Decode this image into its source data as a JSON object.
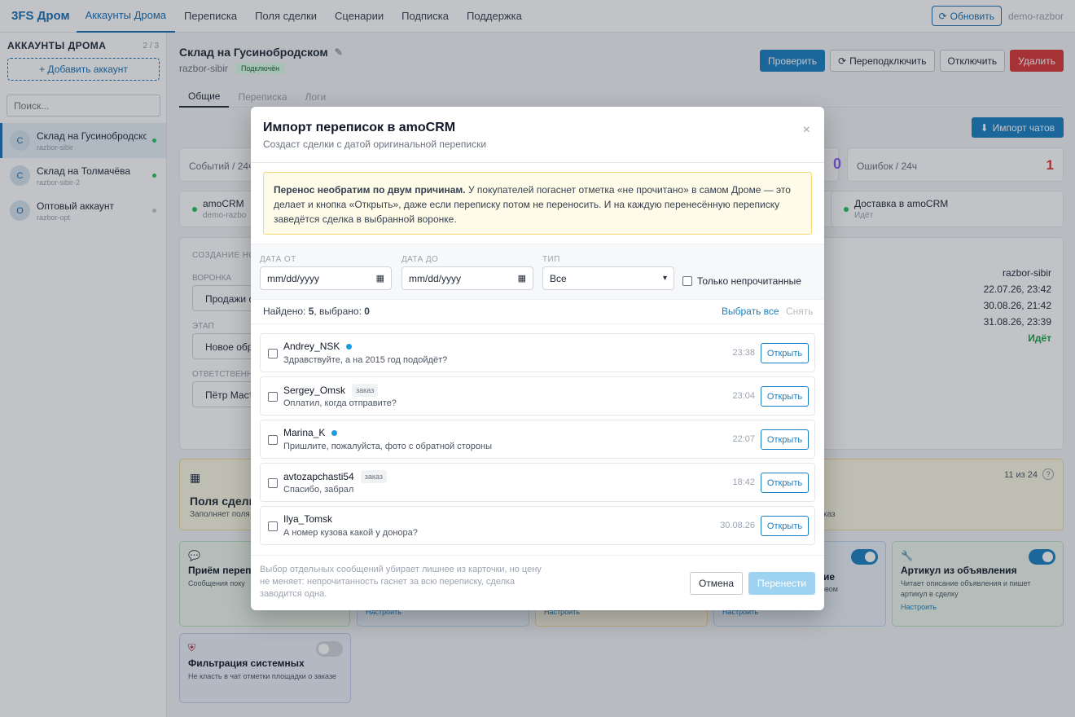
{
  "topbar": {
    "brand": "3FS Дром",
    "nav": [
      "Аккаунты Дрома",
      "Переписка",
      "Поля сделки",
      "Сценарии",
      "Подписка",
      "Поддержка"
    ],
    "refresh_label": "Обновить",
    "user": "demo-razbor"
  },
  "sidebar": {
    "title": "АККАУНТЫ ДРОМА",
    "count": "2 / 3",
    "add_label": "+ Добавить аккаунт",
    "search_placeholder": "Поиск...",
    "accounts": [
      {
        "initial": "С",
        "name": "Склад на Гусинобродском",
        "login": "razbor-sibir"
      },
      {
        "initial": "С",
        "name": "Склад на Толмачёва",
        "login": "razbor-sibir-2"
      },
      {
        "initial": "О",
        "name": "Оптовый аккаунт",
        "login": "razbor-opt"
      }
    ]
  },
  "main": {
    "title": "Склад на Гусинобродском",
    "login": "razbor-sibir",
    "status": "Подключён",
    "actions": {
      "check": "Проверить",
      "reconnect": "Переподключить",
      "disconnect": "Отключить",
      "delete": "Удалить"
    },
    "tabs": [
      "Общие",
      "Переписка",
      "Логи"
    ],
    "import_label": "Импорт чатов",
    "stats": {
      "events_label": "Событий / 24ч",
      "errors_label": "Ошибок / 24ч",
      "errors_value": "1",
      "partial_value": "0"
    },
    "integrations": {
      "amocrm_title": "amoCRM",
      "amocrm_sub": "demo-razbo",
      "delivery_title": "Доставка в amoCRM",
      "delivery_sub": "Идёт"
    },
    "deal": {
      "section": "СОЗДАНИЕ НО",
      "pipeline_label": "ВОРОНКА",
      "pipeline_value": "Продажи с",
      "stage_label": "ЭТАП",
      "stage_value": "Новое обр",
      "resp_label": "ОТВЕТСТВЕНН",
      "resp_value": "Пётр Маст"
    },
    "info": {
      "login": "razbor-sibir",
      "date1": "22.07.26, 23:42",
      "date2": "30.08.26, 21:42",
      "date3": "31.08.26, 23:39",
      "status": "Идёт"
    },
    "fields_card": {
      "title": "Поля сделки",
      "desc": "Заполняет поля",
      "count": "11 из 24",
      "help": "?",
      "tail": "каз"
    },
    "features": {
      "f1_title": "Приём переп",
      "f1_desc": "Сообщения поку",
      "f2_link": "Настроить",
      "f3_link": "Настроить",
      "f4_title": "щение",
      "f4_desc": "ервом",
      "f4_link": "Настроить",
      "f5_title": "Артикул из объявления",
      "f5_desc": "Читает описание объявления и пишет артикул в сделку",
      "f5_link": "Настроить",
      "f6_title": "Фильтрация системных",
      "f6_desc": "Не класть в чат отметки площадки о заказе"
    }
  },
  "modal": {
    "title": "Импорт переписок в amoCRM",
    "subtitle": "Создаст сделки с датой оригинальной переписки",
    "close": "×",
    "warning_bold": "Перенос необратим по двум причинам.",
    "warning_text": " У покупателей погаснет отметка «не прочитано» в самом Дроме — это делает и кнопка «Открыть», даже если переписку потом не переносить. И на каждую перенесённую переписку заведётся сделка в выбранной воронке.",
    "filters": {
      "date_from_label": "ДАТА ОТ",
      "date_from_value": "mm/dd/yyyy",
      "date_to_label": "ДАТА ДО",
      "date_to_value": "mm/dd/yyyy",
      "type_label": "ТИП",
      "type_value": "Все",
      "unread_only": "Только непрочитанные"
    },
    "found_prefix": "Найдено: ",
    "found_count": "5",
    "selected_prefix": ", выбрано: ",
    "selected_count": "0",
    "select_all": "Выбрать все",
    "deselect": "Снять",
    "open_label": "Открыть",
    "chats": [
      {
        "name": "Andrey_NSK",
        "msg": "Здравствуйте, а на 2015 год подойдёт?",
        "time": "23:38",
        "unread": true,
        "tag": ""
      },
      {
        "name": "Sergey_Omsk",
        "msg": "Оплатил, когда отправите?",
        "time": "23:04",
        "unread": false,
        "tag": "заказ"
      },
      {
        "name": "Marina_K",
        "msg": "Пришлите, пожалуйста, фото с обратной стороны",
        "time": "22:07",
        "unread": true,
        "tag": ""
      },
      {
        "name": "avtozapchasti54",
        "msg": "Спасибо, забрал",
        "time": "18:42",
        "unread": false,
        "tag": "заказ"
      },
      {
        "name": "Ilya_Tomsk",
        "msg": "А номер кузова какой у донора?",
        "time": "30.08.26",
        "unread": false,
        "tag": ""
      }
    ],
    "note": "Выбор отдельных сообщений убирает лишнее из карточки, но цену не меняет: непрочитанность гаснет за всю переписку, сделка заводится одна.",
    "cancel": "Отмена",
    "transfer": "Перенести"
  },
  "colors": {
    "accent": "#1a7fc2",
    "danger": "#d93636",
    "success": "#22c55e",
    "warning_bg": "#fefbe8"
  }
}
